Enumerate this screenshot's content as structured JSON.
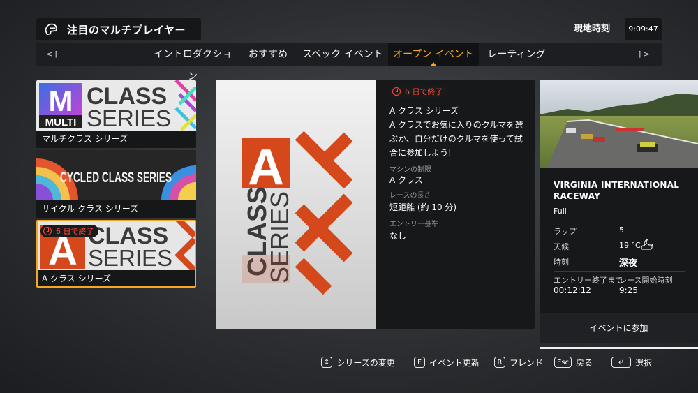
{
  "header": {
    "title": "注目のマルチプレイヤー",
    "clock_label": "現地時刻",
    "clock_value": "9:09:47"
  },
  "tabs": {
    "left_arrow": "< [",
    "right_arrow": "] >",
    "items": [
      {
        "label": "イントロダクション"
      },
      {
        "label": "おすすめ"
      },
      {
        "label": "スペック イベント"
      },
      {
        "label": "オープン イベント",
        "active": true
      },
      {
        "label": "レーティング"
      }
    ]
  },
  "series_list": [
    {
      "label": "マルチクラス シリーズ",
      "art": {
        "letter": "M",
        "line1": "CLASS",
        "line2": "SERIES",
        "tag": "MULTI"
      }
    },
    {
      "label": "サイクル クラス シリーズ",
      "art": {
        "text": "CYCLED CLASS SERIES"
      }
    },
    {
      "label": "A クラス シリーズ",
      "badge": "6 日で終了",
      "selected": true,
      "art": {
        "letter": "A",
        "line1": "CLASS",
        "line2": "SERIES"
      }
    }
  ],
  "big_art": {
    "letter": "A",
    "line1": "CLASS",
    "line2": "SERIES"
  },
  "event": {
    "badge": "6 日で終了",
    "name": "A クラス シリーズ",
    "description": "A クラスでお気に入りのクルマを選ぶか、自分だけのクルマを使って試合に参加しよう!",
    "car_restriction_label": "マシンの制限",
    "car_restriction": "A クラス",
    "race_length_label": "レースの長さ",
    "race_length": "短距離 (約 10 分)",
    "entry_label": "エントリー基準",
    "entry": "なし"
  },
  "track": {
    "name": "VIRGINIA INTERNATIONAL RACEWAY",
    "layout": "Full",
    "laps_label": "ラップ",
    "laps": "5",
    "weather_label": "天候",
    "weather": "19 °C",
    "weather_icon": "partly-cloudy-night-icon",
    "time_label": "時刻",
    "time": "深夜",
    "entry_close_label": "エントリー終了まで",
    "entry_close": "00:12:12",
    "race_start_label": "レース開始時刻",
    "race_start": "9:25",
    "join_label": "イベントに参加"
  },
  "hints": [
    {
      "key": "↕",
      "label": "シリーズの変更",
      "icon": "dpad-updown-icon"
    },
    {
      "key": "F",
      "label": "イベント更新"
    },
    {
      "key": "R",
      "label": "フレンド"
    },
    {
      "key": "Esc",
      "label": "戻る"
    },
    {
      "key": "↵",
      "label": "選択",
      "icon": "enter-key-icon"
    }
  ],
  "colors": {
    "accent": "#f5a623",
    "timer_red": "#ff4a3d",
    "art_orange": "#d5481c"
  }
}
